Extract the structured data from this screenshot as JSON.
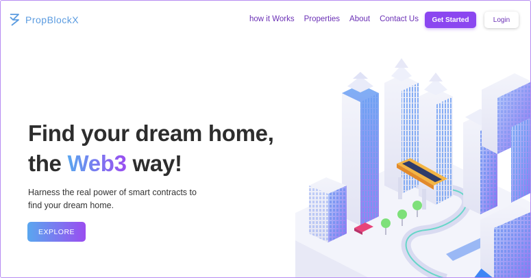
{
  "brand": {
    "name": "PropBlockX",
    "icon": "propblockx-logo-icon",
    "color": "#5a9be0"
  },
  "nav": {
    "items": [
      {
        "label": "how it Works"
      },
      {
        "label": "Properties"
      },
      {
        "label": "About"
      },
      {
        "label": "Contact Us"
      }
    ],
    "get_started_label": "Get Started",
    "login_label": "Login"
  },
  "hero": {
    "headline_line1": "Find your dream home,",
    "headline_the": "the ",
    "headline_highlight": "Web3",
    "headline_end": " way!",
    "subtitle_line1": "Harness the real power of smart contracts to",
    "subtitle_line2": "find your dream home.",
    "explore_label": "EXPLORE"
  },
  "colors": {
    "accent": "#8b47f0",
    "gradient_start": "#5aa7ef",
    "gradient_end": "#9a4df0",
    "nav_text": "#6a2fb5"
  },
  "illustration": {
    "icon": "isometric-city-illustration"
  }
}
